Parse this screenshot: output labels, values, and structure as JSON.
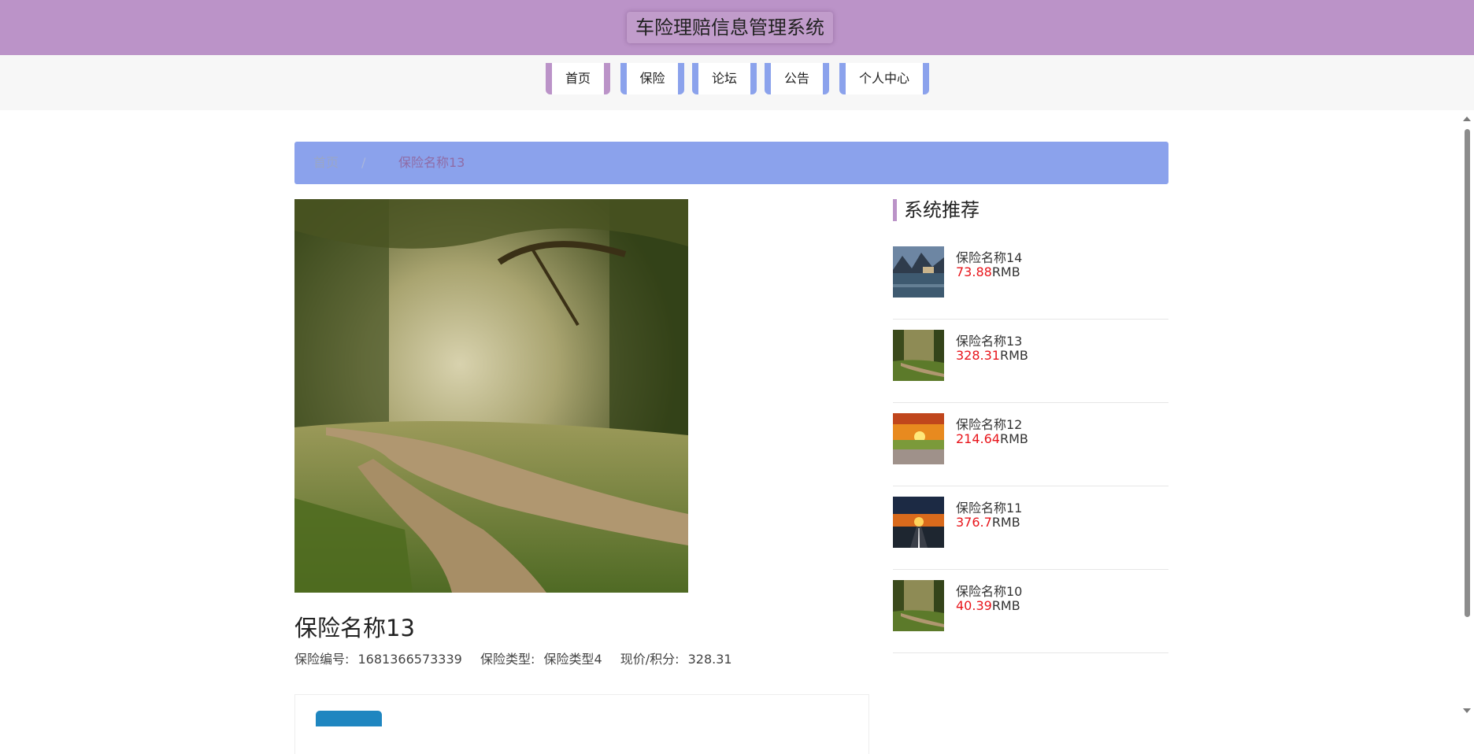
{
  "header": {
    "title": "车险理赔信息管理系统"
  },
  "nav": {
    "items": [
      {
        "label": "首页"
      },
      {
        "label": "保险"
      },
      {
        "label": "论坛"
      },
      {
        "label": "公告"
      },
      {
        "label": "个人中心"
      }
    ]
  },
  "breadcrumb": {
    "home": "首页",
    "separator": "/",
    "current": "保险名称13"
  },
  "product": {
    "title": "保险名称13",
    "number_label": "保险编号:",
    "number_value": "1681366573339",
    "type_label": "保险类型:",
    "type_value": "保险类型4",
    "price_label": "现价/积分:",
    "price_value": "328.31"
  },
  "recommend": {
    "heading": "系统推荐",
    "currency": "RMB",
    "items": [
      {
        "name": "保险名称14",
        "price": "73.88"
      },
      {
        "name": "保险名称13",
        "price": "328.31"
      },
      {
        "name": "保险名称12",
        "price": "214.64"
      },
      {
        "name": "保险名称11",
        "price": "376.7"
      },
      {
        "name": "保险名称10",
        "price": "40.39"
      }
    ]
  },
  "colors": {
    "header_bg": "#bb93c8",
    "nav_accent": "#8ba2ec",
    "price_red": "#e8151b"
  }
}
